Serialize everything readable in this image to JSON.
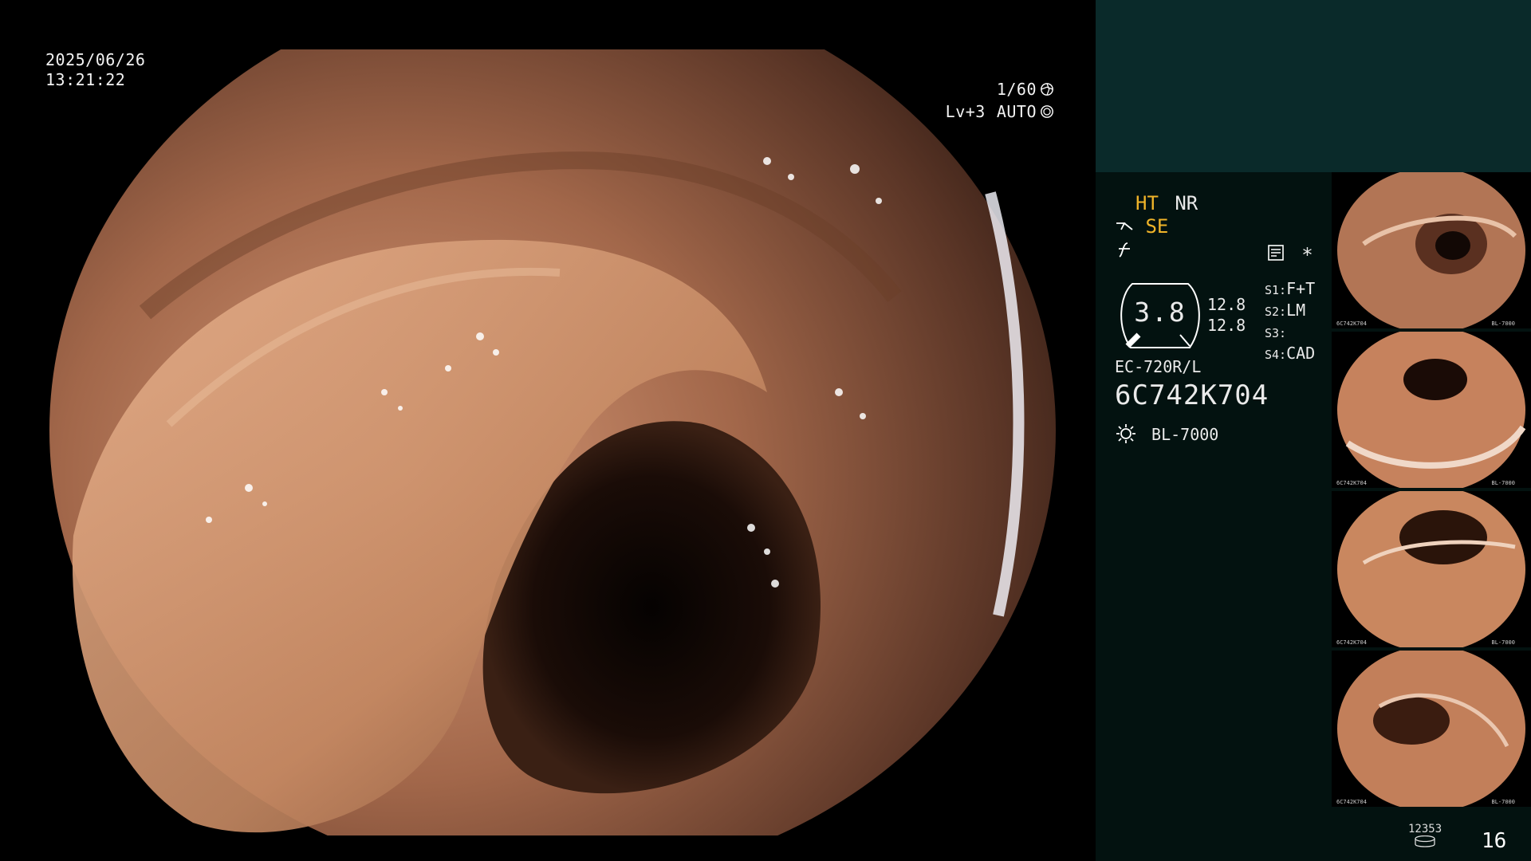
{
  "osd": {
    "date": "2025/06/26",
    "time": "13:21:22",
    "shutter": "1/60",
    "level": "Lv+3",
    "mode": "AUTO"
  },
  "panel": {
    "ht": "HT",
    "nr": "NR",
    "se": "SE",
    "asterisk": "*",
    "gauge_value": "3.8",
    "val_top": "12.8",
    "val_bottom": "12.8",
    "settings": [
      {
        "key": "S1:",
        "value": "F+T"
      },
      {
        "key": "S2:",
        "value": "LM"
      },
      {
        "key": "S3:",
        "value": ""
      },
      {
        "key": "S4:",
        "value": "CAD"
      }
    ],
    "scope_model": "EC-720R/L",
    "scope_serial": "6C742K704",
    "light_source": "BL-7000",
    "storage_count": "12353",
    "frame_count": "16"
  },
  "thumbnails": [
    {
      "label": "6C742K704",
      "source": "BL-7000"
    },
    {
      "label": "6C742K704",
      "source": "BL-7000"
    },
    {
      "label": "6C742K704",
      "source": "BL-7000"
    },
    {
      "label": "6C742K704",
      "source": "BL-7000"
    }
  ],
  "colors": {
    "panel_bg": "#031210",
    "panel_top": "#0a2a2a",
    "accent_yellow": "#f0b429",
    "mucosa": "#b87a58"
  }
}
